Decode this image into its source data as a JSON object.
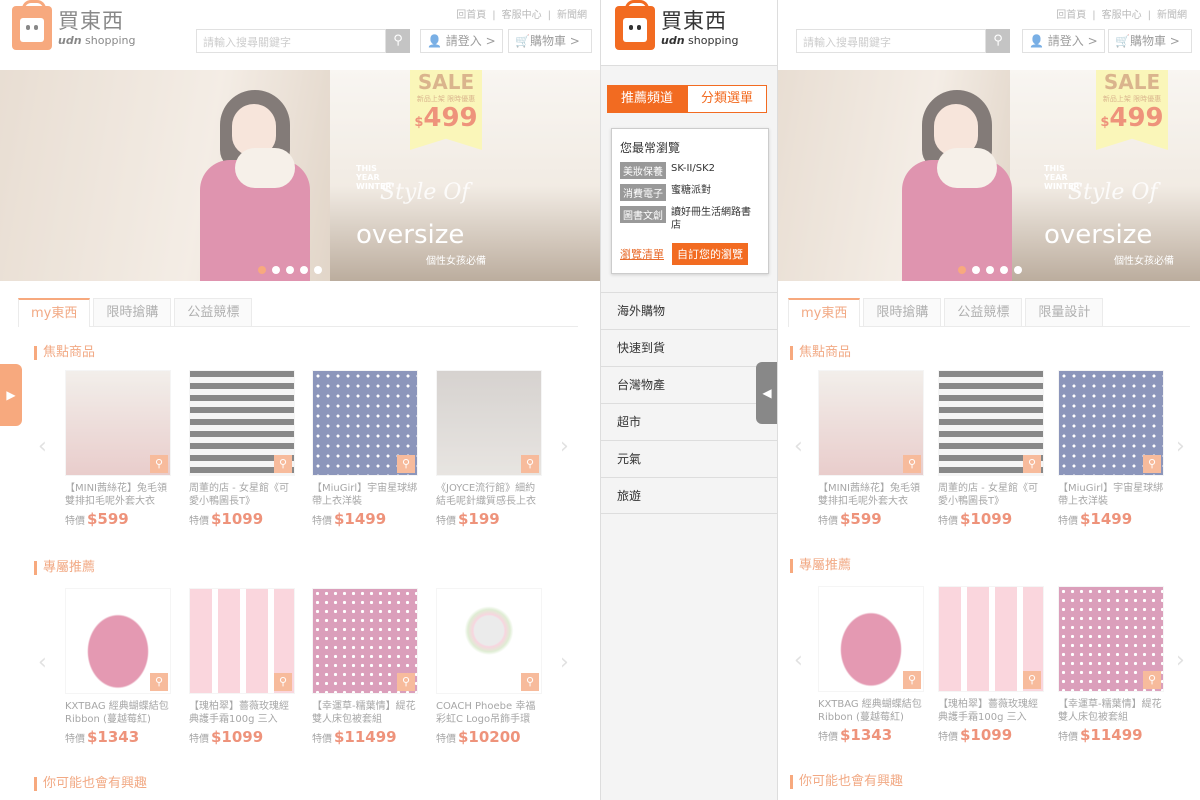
{
  "header": {
    "logo_cn": "買東西",
    "logo_en_brand": "udn",
    "logo_en_rest": " shopping",
    "toplinks": [
      "回首頁",
      "|",
      "客服中心",
      "|",
      "新聞網"
    ],
    "search_placeholder": "請輸入搜尋關鍵字",
    "search_icon": "search-icon",
    "login": "請登入",
    "cart": "購物車"
  },
  "banner": {
    "sale_title": "SALE",
    "sale_sub": "新品上架 限時優惠",
    "sale_currency": "$",
    "sale_price": "499",
    "this_year": "THIS\nYEAR\nWINTER",
    "style": "Style Of",
    "oversize": "oversize",
    "oversize_sub": "個性女孩必備",
    "dots": 5,
    "active_dot": 1
  },
  "left": {
    "tabs": [
      "my東西",
      "限時搶購",
      "公益競標"
    ],
    "section1": "焦點商品",
    "section2": "專屬推薦",
    "section3": "你可能也會有興趣",
    "featured": [
      {
        "name": "【MINI茜絲花】兔毛領雙排扣毛呢外套大衣",
        "price_label": "特價",
        "price": "$599"
      },
      {
        "name": "周董的店 - 女星館《可愛小鴨圖長T》",
        "price_label": "特價",
        "price": "$1099"
      },
      {
        "name": "【MiuGirl】宇宙星球綁帶上衣洋裝",
        "price_label": "特價",
        "price": "$1499"
      },
      {
        "name": "《JOYCE流行館》細約結毛呢針織質感長上衣",
        "price_label": "特價",
        "price": "$199"
      }
    ],
    "recommend": [
      {
        "name": "KXTBAG 經典蝴蝶結包 Ribbon (蔓越莓紅)",
        "price_label": "特價",
        "price": "$1343"
      },
      {
        "name": "【瑰柏翠】薔薇玫瑰經典護手霜100g 三入",
        "price_label": "特價",
        "price": "$1099"
      },
      {
        "name": "【幸運草-糯葉情】緹花雙人床包被套組",
        "price_label": "特價",
        "price": "$11499"
      },
      {
        "name": "COACH Phoebe 幸福彩虹C Logo吊飾手環",
        "price_label": "特價",
        "price": "$10200"
      }
    ]
  },
  "menu": {
    "tab_active": "推薦頻道",
    "tab_other": "分類選單",
    "history_title": "您最常瀏覽",
    "history": [
      {
        "cat": "美妝保養",
        "val": "SK-II/SK2"
      },
      {
        "cat": "消費電子",
        "val": "蜜糖派對"
      },
      {
        "cat": "圖書文創",
        "val": "讀好冊生活網路書店"
      }
    ],
    "list_link": "瀏覽清單",
    "custom_btn": "自訂您的瀏覽",
    "items": [
      "海外購物",
      "快速到貨",
      "台灣物產",
      "超市",
      "元氣",
      "旅遊"
    ]
  },
  "right": {
    "tabs": [
      "my東西",
      "限時搶購",
      "公益競標",
      "限量設計"
    ],
    "section1": "焦點商品",
    "section2": "專屬推薦",
    "section3": "你可能也會有興趣",
    "featured": [
      {
        "name": "【MINI茜絲花】兔毛領雙排扣毛呢外套大衣",
        "price_label": "特價",
        "price": "$599"
      },
      {
        "name": "周董的店 - 女星館《可愛小鴨圖長T》",
        "price_label": "特價",
        "price": "$1099"
      },
      {
        "name": "【MiuGirl】宇宙星球綁帶上衣洋裝",
        "price_label": "特價",
        "price": "$1499"
      }
    ],
    "recommend": [
      {
        "name": "KXTBAG 經典蝴蝶結包 Ribbon (蔓越莓紅)",
        "price_label": "特價",
        "price": "$1343"
      },
      {
        "name": "【瑰柏翠】薔薇玫瑰經典護手霜100g 三入",
        "price_label": "特價",
        "price": "$1099"
      },
      {
        "name": "【幸運草-糯葉情】緹花雙人床包被套組",
        "price_label": "特價",
        "price": "$11499"
      }
    ]
  },
  "colors": {
    "accent": "#f26b21",
    "price": "#e2451d"
  }
}
